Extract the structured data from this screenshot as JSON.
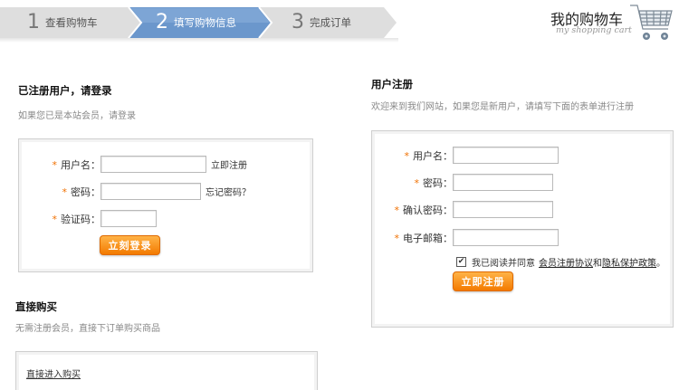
{
  "steps": [
    {
      "num": "1",
      "label": "查看购物车"
    },
    {
      "num": "2",
      "label": "填写购物信息"
    },
    {
      "num": "3",
      "label": "完成订单"
    }
  ],
  "cart": {
    "title": "我的购物车",
    "subtitle": "my shopping cart"
  },
  "login": {
    "title": "已注册用户，请登录",
    "subtitle": "如果您已是本站会员，请登录",
    "username_label": "用户名：",
    "register_link": "立即注册",
    "password_label": "密码：",
    "forgot_link": "忘记密码？",
    "captcha_label": "验证码：",
    "button": "立刻登录",
    "required_mark": "*"
  },
  "direct": {
    "title": "直接购买",
    "subtitle": "无需注册会员，直接下订单购买商品",
    "link": "直接进入购买"
  },
  "register": {
    "title": "用户注册",
    "subtitle": "欢迎来到我们网站，如果您是新用户，请填写下面的表单进行注册",
    "username_label": "用户名：",
    "password_label": "密码：",
    "confirm_label": "确认密码：",
    "email_label": "电子邮箱：",
    "agree_prefix": "我已阅读并同意",
    "agree_terms": "会员注册协议",
    "agree_and": "和",
    "agree_privacy": "隐私保护政策",
    "agree_suffix": "。",
    "checked_mark": "✔",
    "button": "立即注册",
    "required_mark": "*"
  },
  "colors": {
    "accent_orange": "#f37a00",
    "step_active": "#5f8fc8",
    "step_inactive": "#dcdcdc"
  }
}
